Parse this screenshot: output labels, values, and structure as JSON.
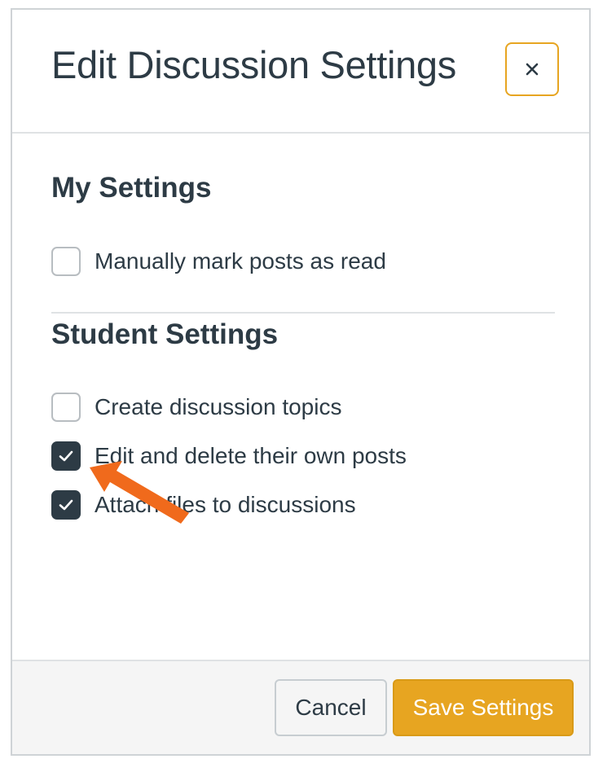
{
  "dialog": {
    "title": "Edit Discussion Settings",
    "close_label": "×"
  },
  "my_settings": {
    "heading": "My Settings",
    "options": [
      {
        "label": "Manually mark posts as read",
        "checked": false
      }
    ]
  },
  "student_settings": {
    "heading": "Student Settings",
    "options": [
      {
        "label": "Create discussion topics",
        "checked": false
      },
      {
        "label": "Edit and delete their own posts",
        "checked": true
      },
      {
        "label": "Attach files to discussions",
        "checked": true
      }
    ]
  },
  "footer": {
    "cancel_label": "Cancel",
    "save_label": "Save Settings"
  },
  "colors": {
    "text": "#2d3b45",
    "accent": "#e7a521",
    "checkbox_checked": "#2d3b45",
    "annotation_arrow": "#f06a1c"
  },
  "icons": {
    "close": "close-icon",
    "check": "check-icon",
    "annotation": "arrow-annotation-icon"
  }
}
